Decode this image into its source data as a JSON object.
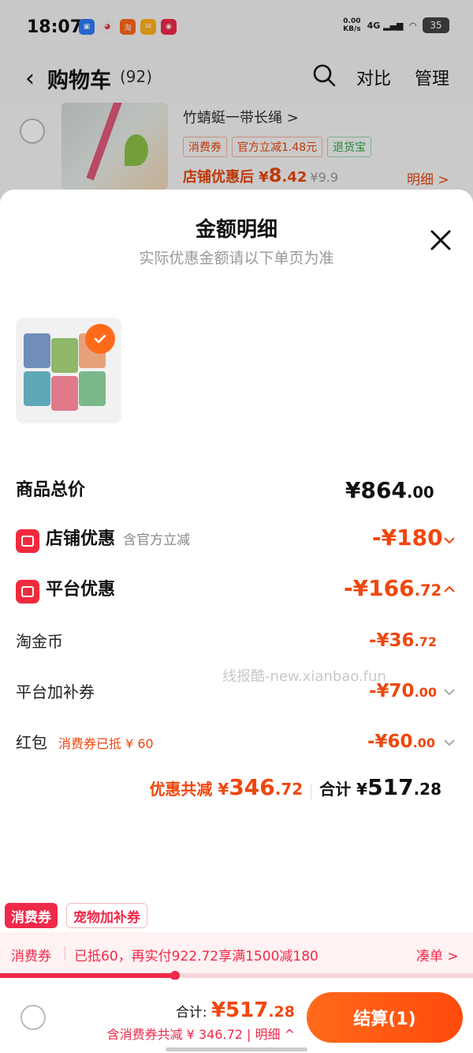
{
  "status": {
    "time": "18:07",
    "net_speed_top": "0.00",
    "net_speed_unit": "KB/s",
    "signal": "4G",
    "battery": "35",
    "app_icons": [
      "message-app-icon",
      "pet-app-icon",
      "taobao-app-icon",
      "mail-app-icon",
      "red-app-icon"
    ]
  },
  "header": {
    "title": "购物车",
    "count": "(92)",
    "compare": "对比",
    "manage": "管理"
  },
  "cart_item": {
    "name": "竹蜻蜓一带长绳 >",
    "tags": [
      "消费券",
      "官方立减1.48元",
      "退货宝"
    ],
    "after_label": "店铺优惠后 ¥",
    "after_int": "8",
    "after_dec": ".42",
    "orig_price": "¥9.9",
    "detail": "明细 >"
  },
  "sheet": {
    "title": "金额明细",
    "subtitle": "实际优惠金额请以下单页为准",
    "rows": {
      "total_label": "商品总价",
      "total_int": "¥864",
      "total_dec": ".00",
      "store_label": "店铺优惠",
      "store_note": "含官方立减",
      "store_int": "-¥180",
      "platform_label": "平台优惠",
      "platform_int": "-¥166",
      "platform_dec": ".72",
      "coin_label": "淘金币",
      "coin_int": "-¥36",
      "coin_dec": ".72",
      "subsidy_label": "平台加补券",
      "subsidy_int": "-¥70",
      "subsidy_dec": ".00",
      "hongbao_label": "红包",
      "hongbao_note": "消费券已抵 ¥ 60",
      "hongbao_int": "-¥60",
      "hongbao_dec": ".00"
    },
    "watermark": "线报酷-new.xianbao.fun",
    "summary": {
      "save_label": "优惠共减 ¥",
      "save_int": "346",
      "save_dec": ".72",
      "total_label": "合计 ¥",
      "total_int": "517",
      "total_dec": ".28"
    }
  },
  "coupon": {
    "tab1": "消费券",
    "tab2": "宠物加补券",
    "bar_left": "消费券",
    "bar_msg": "已抵60，再实付922.72享满1500减180",
    "bar_right": "凑单 >",
    "progress": 0.37
  },
  "bottom": {
    "total_label": "合计: ",
    "total_int": "¥517",
    "total_dec": ".28",
    "save_text": "含消费券共减 ¥ 346.72 | 明细 ^",
    "checkout": "结算(1)"
  },
  "colors": {
    "accent": "#f0470d",
    "coupon_red": "#f0294a",
    "checkout_orange": "#ff6a1a"
  }
}
